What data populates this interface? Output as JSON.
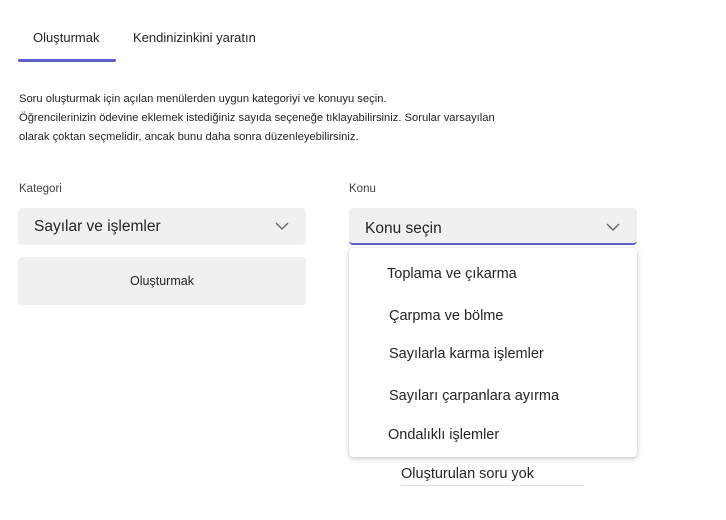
{
  "tabs": [
    {
      "label": "Oluşturmak",
      "active": true
    },
    {
      "label": "Kendinizinkini yaratın",
      "active": false
    }
  ],
  "description": {
    "lines": [
      "Soru oluşturmak için açılan menülerden uygun kategoriyi ve konuyu seçin.",
      "Öğrencilerinizin ödevine eklemek istediğiniz sayıda seçeneğe tıklayabilirsiniz. Sorular varsayılan",
      "olarak çoktan seçmelidir, ancak bunu daha sonra düzenleyebilirsiniz."
    ]
  },
  "category": {
    "label": "Kategori",
    "selected": "Sayılar ve işlemler",
    "icon": "chevron-down-icon"
  },
  "topic": {
    "label": "Konu",
    "placeholder": "Konu seçin",
    "icon": "chevron-down-icon",
    "options": [
      "Toplama ve çıkarma",
      "Çarpma ve bölme",
      "Sayılarla karma işlemler",
      "Sayıları çarpanlara ayırma",
      "Ondalıklı işlemler"
    ]
  },
  "create_button": {
    "label": "Oluşturmak"
  },
  "empty_state": {
    "text": "Oluşturulan soru yok"
  },
  "colors": {
    "accent": "#5b5fc7",
    "field_bg": "#f0f0f0",
    "text": "#242424"
  }
}
